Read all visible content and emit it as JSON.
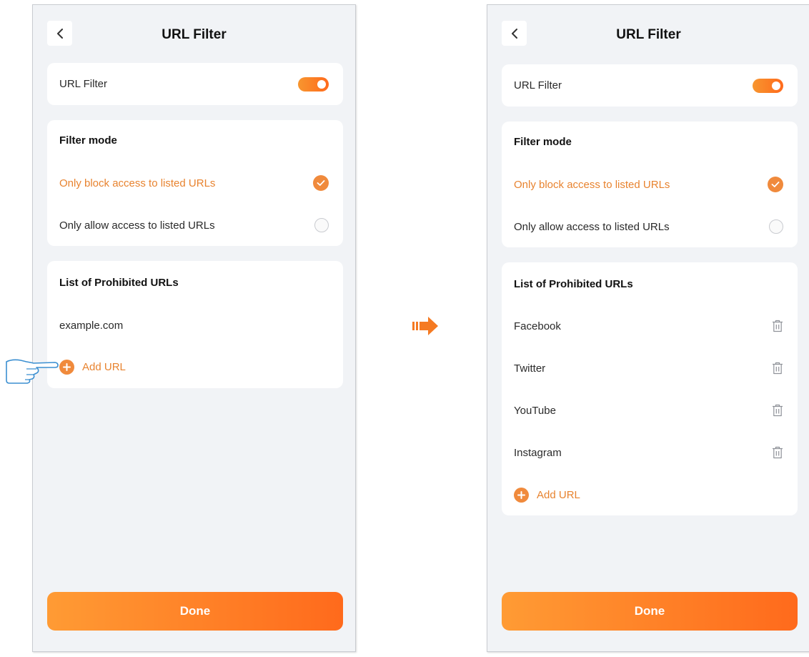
{
  "accent_color": "#f08a3c",
  "left": {
    "title": "URL Filter",
    "toggle": {
      "label": "URL Filter",
      "enabled": true
    },
    "filter_mode": {
      "heading": "Filter mode",
      "options": [
        {
          "label": "Only block access to listed URLs",
          "selected": true
        },
        {
          "label": "Only allow access to listed URLs",
          "selected": false
        }
      ]
    },
    "list": {
      "heading": "List of Prohibited URLs",
      "items": [
        "example.com"
      ],
      "add_label": "Add URL"
    },
    "done_label": "Done"
  },
  "right": {
    "title": "URL Filter",
    "toggle": {
      "label": "URL Filter",
      "enabled": true
    },
    "filter_mode": {
      "heading": "Filter mode",
      "options": [
        {
          "label": "Only block access to listed URLs",
          "selected": true
        },
        {
          "label": "Only allow access to listed URLs",
          "selected": false
        }
      ]
    },
    "list": {
      "heading": "List of Prohibited URLs",
      "items": [
        "Facebook",
        "Twitter",
        "YouTube",
        "Instagram"
      ],
      "add_label": "Add URL"
    },
    "done_label": "Done"
  },
  "icons": {
    "back": "chevron-left-icon",
    "check": "checkmark-icon",
    "add": "plus-circle-icon",
    "delete": "trash-icon",
    "transition": "arrow-right-icon",
    "pointer": "pointing-hand-icon"
  }
}
